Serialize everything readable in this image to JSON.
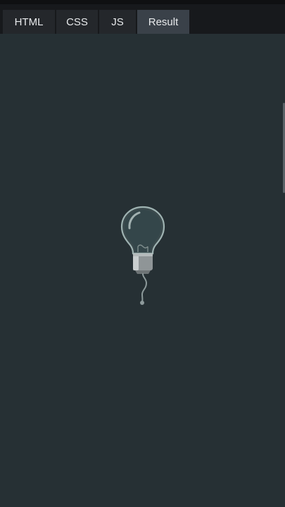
{
  "tabs": [
    {
      "label": "HTML",
      "active": false
    },
    {
      "label": "CSS",
      "active": false
    },
    {
      "label": "JS",
      "active": false
    },
    {
      "label": "Result",
      "active": true
    }
  ],
  "result": {
    "illustration": "lightbulb-icon"
  },
  "colors": {
    "background": "#263034",
    "topbar": "#17191c",
    "tab": "#24272b",
    "tab_active": "#3a4149",
    "tab_text": "#e8eaec"
  }
}
